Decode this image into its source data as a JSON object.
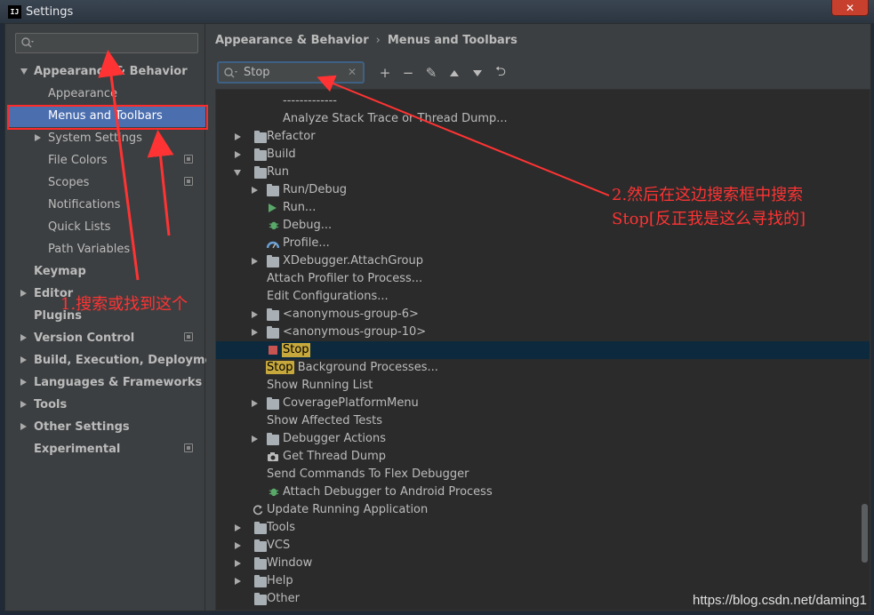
{
  "window": {
    "app_icon": "IJ",
    "title": "Settings",
    "close": "✕"
  },
  "sidebar": {
    "search_value": "",
    "items": [
      {
        "label": "Appearance & Behavior"
      },
      {
        "label": "Appearance"
      },
      {
        "label": "Menus and Toolbars"
      },
      {
        "label": "System Settings"
      },
      {
        "label": "File Colors"
      },
      {
        "label": "Scopes"
      },
      {
        "label": "Notifications"
      },
      {
        "label": "Quick Lists"
      },
      {
        "label": "Path Variables"
      },
      {
        "label": "Keymap"
      },
      {
        "label": "Editor"
      },
      {
        "label": "Plugins"
      },
      {
        "label": "Version Control"
      },
      {
        "label": "Build, Execution, Deployment"
      },
      {
        "label": "Languages & Frameworks"
      },
      {
        "label": "Tools"
      },
      {
        "label": "Other Settings"
      },
      {
        "label": "Experimental"
      }
    ]
  },
  "breadcrumb": {
    "parent": "Appearance & Behavior",
    "separator": "›",
    "current": "Menus and Toolbars"
  },
  "toolbar": {
    "search_value": "Stop",
    "clear": "✕",
    "add": "+",
    "remove": "−",
    "edit": "✎",
    "undo": "⮌"
  },
  "tree": {
    "rows": [
      {
        "label": "-------------"
      },
      {
        "label": "Analyze Stack Trace or Thread Dump..."
      },
      {
        "label": "Refactor"
      },
      {
        "label": "Build"
      },
      {
        "label": "Run"
      },
      {
        "label": "Run/Debug"
      },
      {
        "label": "Run..."
      },
      {
        "label": "Debug..."
      },
      {
        "label": "Profile..."
      },
      {
        "label": "XDebugger.AttachGroup"
      },
      {
        "label": "Attach Profiler to Process..."
      },
      {
        "label": "Edit Configurations..."
      },
      {
        "label": "<anonymous-group-6>"
      },
      {
        "label": "<anonymous-group-10>"
      },
      {
        "label": "Stop"
      },
      {
        "label_hl": "Stop",
        "label": " Background Processes..."
      },
      {
        "label": "Show Running List"
      },
      {
        "label": "CoveragePlatformMenu"
      },
      {
        "label": "Show Affected Tests"
      },
      {
        "label": "Debugger Actions"
      },
      {
        "label": "Get Thread Dump"
      },
      {
        "label": "Send Commands To Flex Debugger"
      },
      {
        "label": "Attach Debugger to Android Process"
      },
      {
        "label": "Update Running Application"
      },
      {
        "label": "Tools"
      },
      {
        "label": "VCS"
      },
      {
        "label": "Window"
      },
      {
        "label": "Help"
      },
      {
        "label": "Other"
      }
    ]
  },
  "annotations": {
    "step1": "1.搜索或找到这个",
    "step2_line1": "2.然后在这边搜索框中搜索",
    "step2_line2": "Stop[反正我是这么寻找的]",
    "color": "#ff3333"
  },
  "watermark": "https://blog.csdn.net/daming1"
}
